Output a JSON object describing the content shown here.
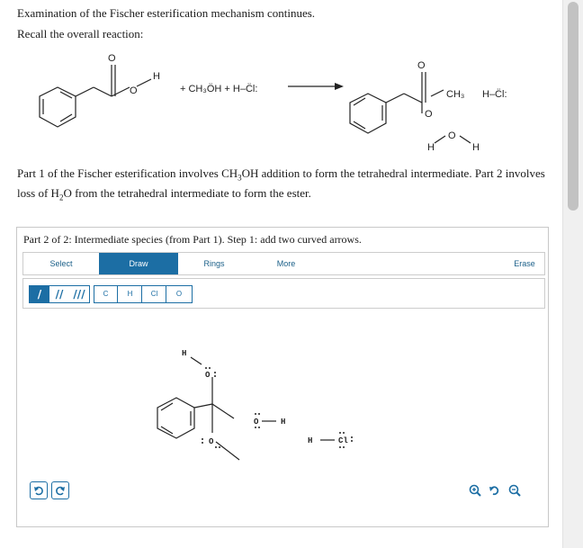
{
  "header": {
    "line1": "Examination of the Fischer esterification mechanism continues.",
    "line2": "Recall the overall reaction:"
  },
  "reaction": {
    "reagents": "+ CH₃ÖH + H–C̈l:",
    "ch3_label": "CH₃",
    "hcl_label": "H–C̈l:",
    "water_label": "H–Ö–H"
  },
  "paragraph": {
    "p1": "Part 1 of the Fischer esterification involves CH",
    "p1_sub": "3",
    "p2": "OH addition to form the tetrahedral intermediate. Part 2 involves loss of H",
    "p2_sub": "2",
    "p3": "O from the tetrahedral intermediate to form the ester."
  },
  "panel": {
    "title": "Part 2 of 2: Intermediate species (from Part 1). Step 1: add two curved arrows."
  },
  "toolbar": {
    "select": "Select",
    "draw": "Draw",
    "rings": "Rings",
    "more": "More",
    "erase": "Erase",
    "active": "Draw"
  },
  "palette": {
    "bonds": [
      "/",
      "//",
      "///"
    ],
    "atoms": [
      "C",
      "H",
      "Cl",
      "O"
    ],
    "selected_bond": "/"
  },
  "canvas_labels": {
    "h_top": "H",
    "o_top": "O",
    "o_right": "O",
    "h_right": "H",
    "o_bottom": "O",
    "h_hcl": "H",
    "cl": "Cl"
  },
  "icons": {
    "undo": "undo-icon",
    "redo": "redo-icon",
    "zoom_in": "zoom-in-icon",
    "reset": "reset-zoom-icon",
    "zoom_out": "zoom-out-icon"
  },
  "colors": {
    "accent": "#1c6ea4",
    "text": "#1a1a1a",
    "border": "#c8c8c8"
  }
}
